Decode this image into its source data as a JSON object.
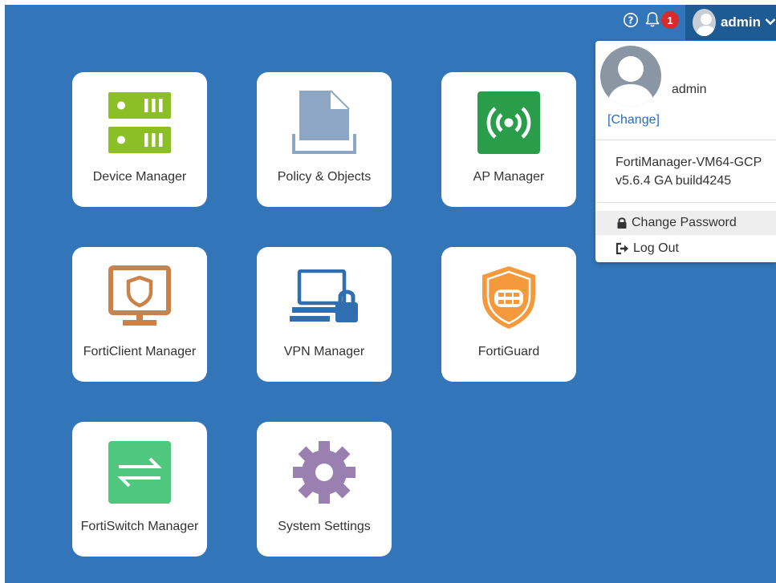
{
  "topbar": {
    "notification_count": "1",
    "username": "admin"
  },
  "tiles": [
    {
      "label": "Device Manager"
    },
    {
      "label": "Policy & Objects"
    },
    {
      "label": "AP Manager"
    },
    {
      "label": "FortiClient Manager"
    },
    {
      "label": "VPN Manager"
    },
    {
      "label": "FortiGuard"
    },
    {
      "label": "FortiSwitch Manager"
    },
    {
      "label": "System Settings"
    }
  ],
  "user_menu": {
    "username": "admin",
    "change_label": "[Change]",
    "product_line1": "FortiManager-VM64-GCP",
    "product_line2": "v5.6.4 GA build4245",
    "change_password_label": "Change Password",
    "logout_label": "Log Out"
  },
  "colors": {
    "background": "#3276b9",
    "user_button": "#1e5a93",
    "badge": "#d92b2b",
    "device_manager_icon": "#8cbf26",
    "ap_manager_icon": "#2a9d4a",
    "forticlient_icon": "#c8824a",
    "fortiguard_icon": "#f59a3c",
    "fortiswitch_icon": "#4fc77f",
    "system_settings_icon": "#9a7fb1",
    "link": "#2d6bb5"
  }
}
